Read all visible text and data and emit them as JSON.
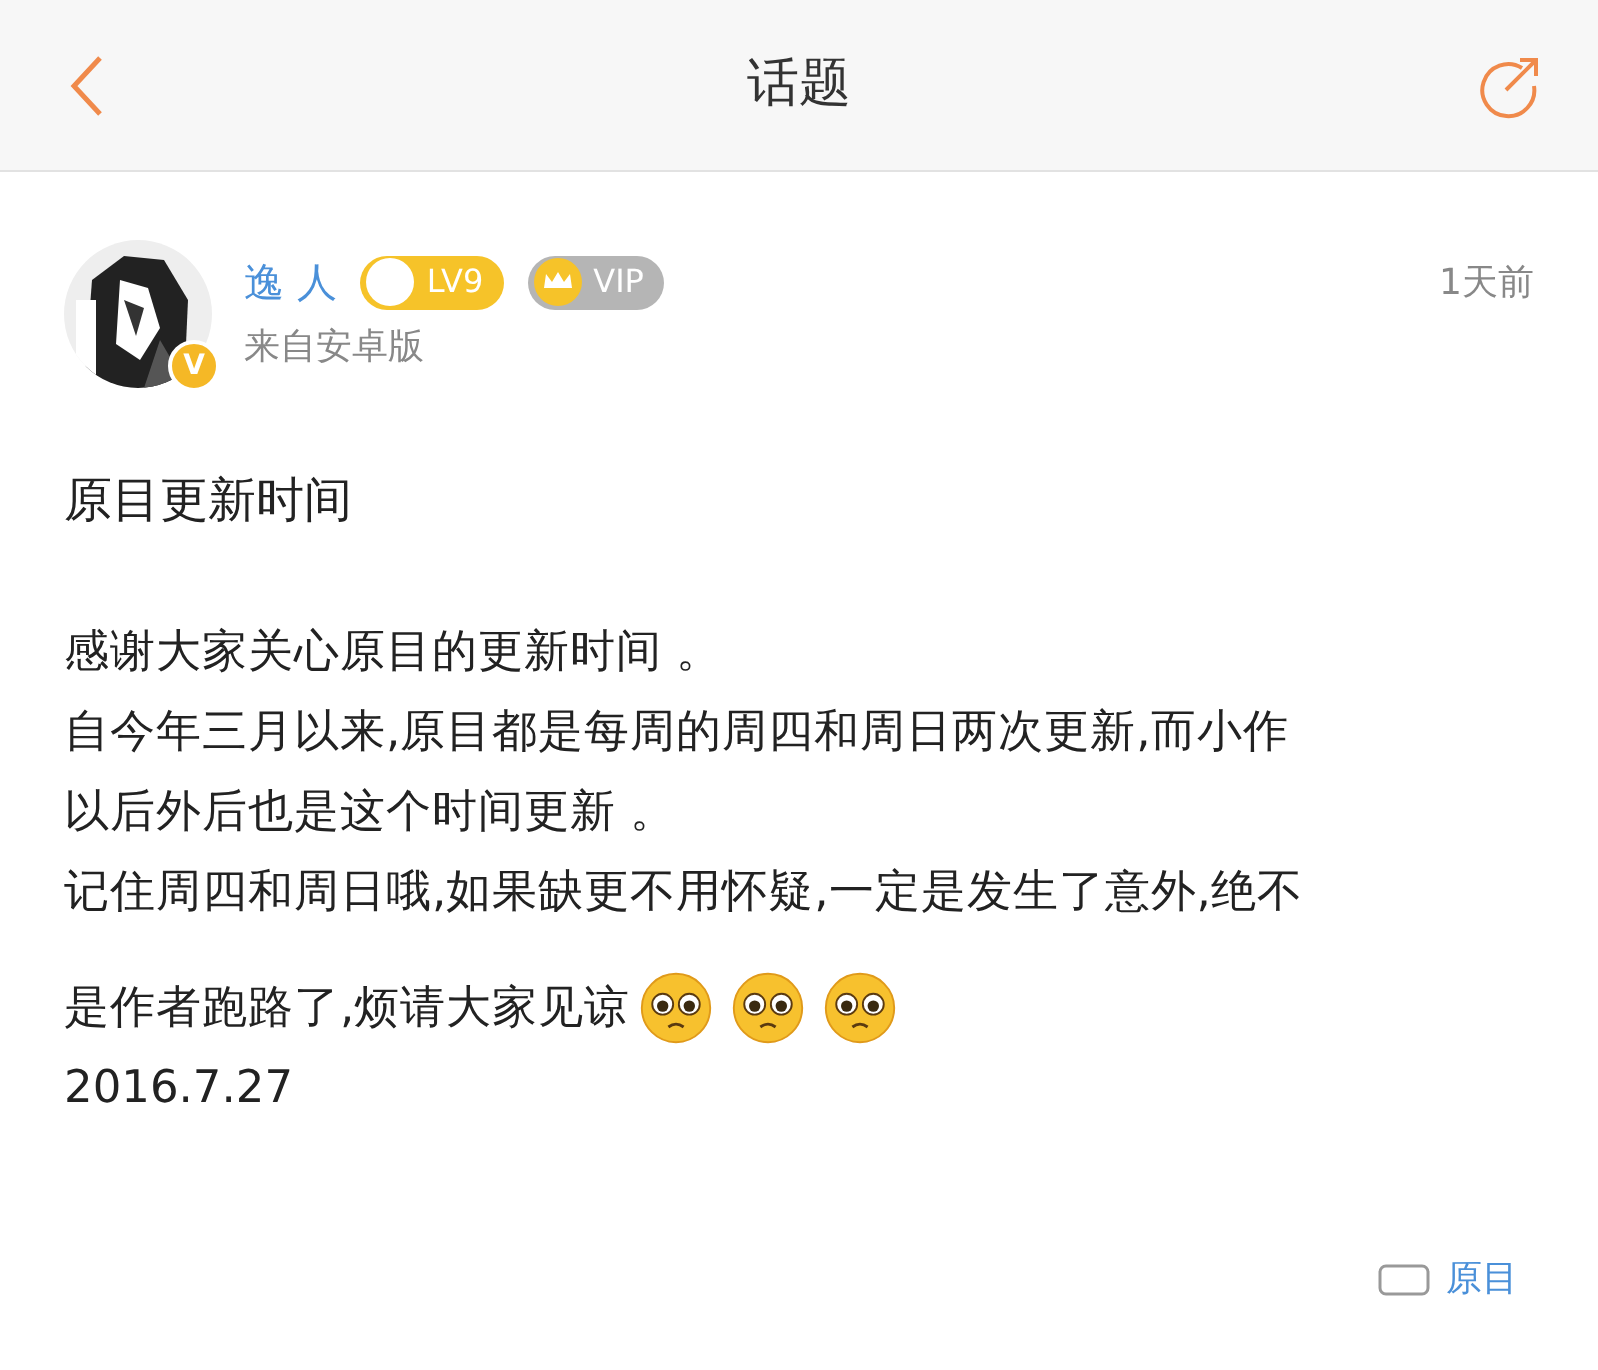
{
  "header": {
    "title": "话题"
  },
  "post": {
    "author": "逸 人",
    "avatar_badge": "V",
    "level": "LV9",
    "vip": "VIP",
    "time": "1天前",
    "source": "来自安卓版",
    "title": "原目更新时间",
    "lines": [
      {
        "text": "感谢大家关心原目的更新时间 。",
        "emoji": false
      },
      {
        "text": "自今年三月以来,原目都是每周的周四和周日两次更新,而小作",
        "emoji": false
      },
      {
        "text": "以后外后也是这个时间更新 。",
        "emoji": false
      },
      {
        "text": "记住周四和周日哦,如果缺更不用怀疑,一定是发生了意外,绝不",
        "emoji": false
      },
      {
        "text": "是作者跑路了,烦请大家见谅",
        "emoji": true
      },
      {
        "text": "2016.7.27",
        "emoji": false
      }
    ],
    "tag": "原目"
  }
}
